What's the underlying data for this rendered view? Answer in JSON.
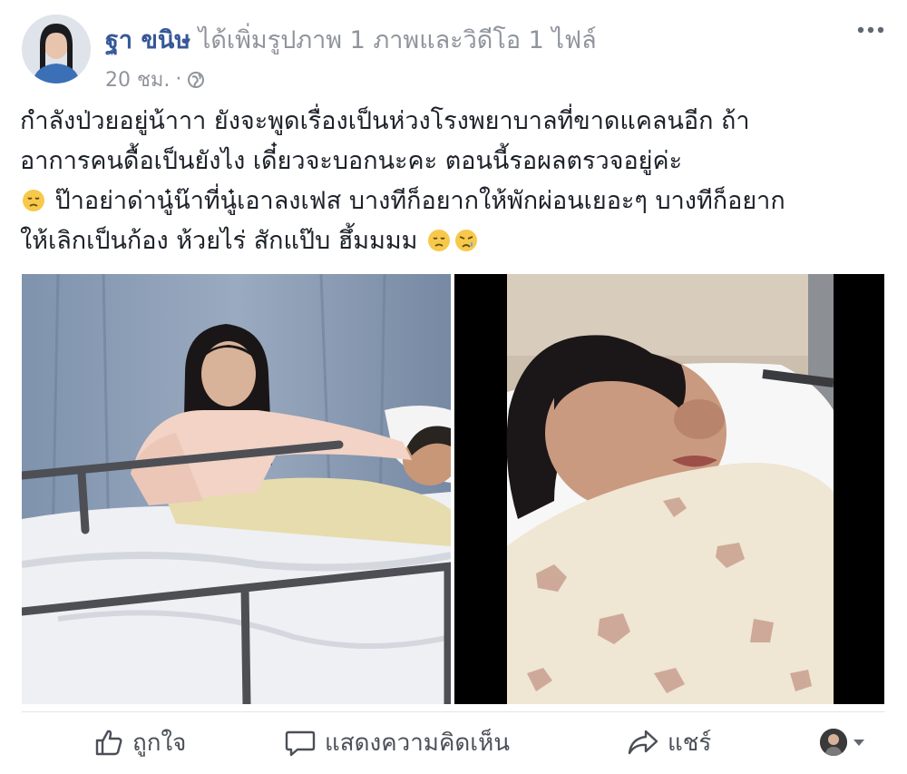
{
  "post": {
    "author_name": "ฐา ขนิษ",
    "action_text": "ได้เพิ่มรูปภาพ 1 ภาพและวิดีโอ 1 ไฟล์",
    "timestamp": "20 ชม.",
    "separator": "·",
    "text_lines": [
      "กำลังป่วยอยู่น้าาา ยังจะพูดเรื่องเป็นห่วงโรงพยาบาลที่ขาดแคลนอีก ถ้า",
      "อาการคนดื้อเป็นยังไง เดี๋ยวจะบอกนะคะ ตอนนี้รอผลตรวจอยู่ค่ะ",
      "ป๊าอย่าด่านู๋น๊าที่นู๋เอาลงเฟส บางทีก็อยากให้พักผ่อนเยอะๆ บางทีก็อยาก",
      "ให้เลิกเป็นก้อง ห้วยไร่ สักแป๊บ ฮึ้มมมม"
    ]
  },
  "actions": {
    "like_label": "ถูกใจ",
    "comment_label": "แสดงความคิดเห็น",
    "share_label": "แชร์"
  },
  "icons": {
    "globe": "globe-icon",
    "more": "more-dots-icon",
    "like": "thumbs-up-icon",
    "comment": "comment-bubble-icon",
    "share": "share-arrow-icon",
    "emoji_sad": "disappointed-face-icon",
    "emoji_cry": "crying-face-icon",
    "dropdown": "caret-down-icon"
  },
  "colors": {
    "link": "#365899",
    "secondary_text": "#90949c",
    "action_text": "#4b4f56"
  }
}
